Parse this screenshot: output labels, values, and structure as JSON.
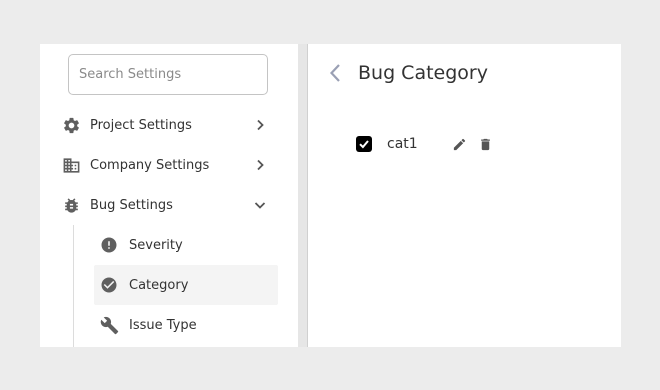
{
  "sidebar": {
    "search": {
      "placeholder": "Search Settings",
      "value": ""
    },
    "items": [
      {
        "label": "Project Settings",
        "icon": "gear-icon",
        "chevron": "chevron-right-icon"
      },
      {
        "label": "Company Settings",
        "icon": "building-icon",
        "chevron": "chevron-right-icon"
      },
      {
        "label": "Bug Settings",
        "icon": "bug-icon",
        "chevron": "chevron-down-icon"
      }
    ],
    "sub_items": [
      {
        "label": "Severity",
        "icon": "alert-circle-icon"
      },
      {
        "label": "Category",
        "icon": "check-circle-icon",
        "active": true
      },
      {
        "label": "Issue Type",
        "icon": "wrench-icon"
      }
    ]
  },
  "main": {
    "title": "Bug Category",
    "categories": [
      {
        "name": "cat1",
        "checked": true
      }
    ]
  },
  "colors": {
    "icon": "#5f5f5f",
    "title_back": "#9aa0b4",
    "active_bg": "#f4f4f4"
  }
}
